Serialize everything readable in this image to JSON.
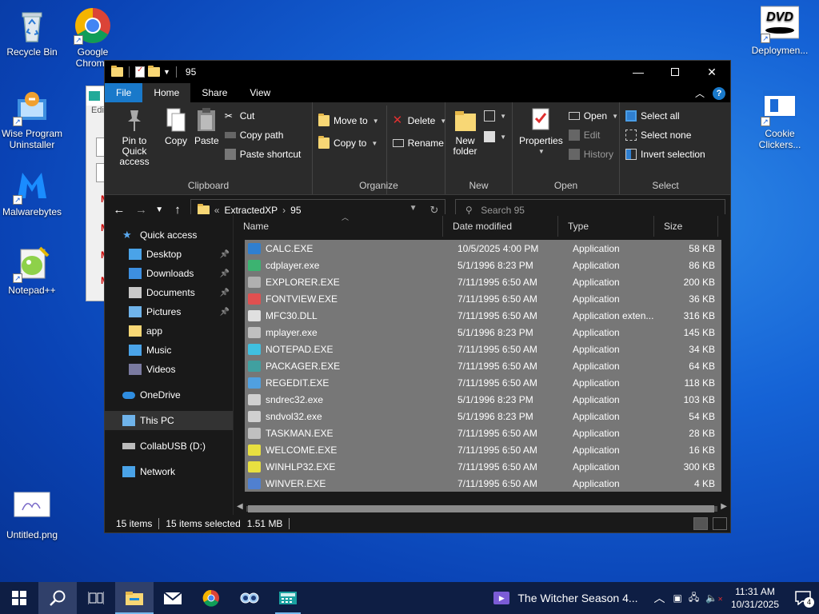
{
  "desktop": {
    "icons_left": [
      {
        "label": "Recycle Bin",
        "icon": "recycle-bin-icon"
      },
      {
        "label": "Google Chrome",
        "icon": "chrome-icon"
      },
      {
        "label": "Wise Program Uninstaller",
        "icon": "uninstaller-icon"
      },
      {
        "label": "Malwarebytes",
        "icon": "malwarebytes-icon"
      },
      {
        "label": "Notepad++",
        "icon": "notepadpp-icon"
      },
      {
        "label": "Untitled.png",
        "icon": "image-file-icon"
      }
    ],
    "icons_right": [
      {
        "label": "Deploymen...",
        "icon": "dvd-icon"
      },
      {
        "label": "Cookie Clickers...",
        "icon": "window-icon"
      }
    ],
    "bg_window_menu": "Edi"
  },
  "explorer": {
    "title": "95",
    "tabs": [
      "File",
      "Home",
      "Share",
      "View"
    ],
    "ribbon": {
      "clipboard": {
        "label": "Clipboard",
        "pin": "Pin to Quick access",
        "copy": "Copy",
        "paste": "Paste",
        "cut": "Cut",
        "copy_path": "Copy path",
        "paste_shortcut": "Paste shortcut"
      },
      "organize": {
        "label": "Organize",
        "move_to": "Move to",
        "copy_to": "Copy to",
        "delete": "Delete",
        "rename": "Rename"
      },
      "new": {
        "label": "New",
        "new_folder": "New folder"
      },
      "open": {
        "label": "Open",
        "properties": "Properties",
        "open": "Open",
        "edit": "Edit",
        "history": "History"
      },
      "select": {
        "label": "Select",
        "select_all": "Select all",
        "select_none": "Select none",
        "invert": "Invert selection"
      }
    },
    "address": {
      "crumbs": [
        "ExtractedXP",
        "95"
      ],
      "overflow": "«"
    },
    "search_placeholder": "Search 95",
    "nav": [
      {
        "label": "Quick access",
        "icon": "star-icon",
        "indent": 1
      },
      {
        "label": "Desktop",
        "icon": "desktop-folder-icon",
        "indent": 2,
        "pinned": true
      },
      {
        "label": "Downloads",
        "icon": "downloads-icon",
        "indent": 2,
        "pinned": true
      },
      {
        "label": "Documents",
        "icon": "documents-icon",
        "indent": 2,
        "pinned": true
      },
      {
        "label": "Pictures",
        "icon": "pictures-icon",
        "indent": 2,
        "pinned": true
      },
      {
        "label": "app",
        "icon": "folder-icon",
        "indent": 2
      },
      {
        "label": "Music",
        "icon": "music-icon",
        "indent": 2
      },
      {
        "label": "Videos",
        "icon": "videos-icon",
        "indent": 2
      },
      {
        "label": "OneDrive",
        "icon": "cloud-icon",
        "indent": 1
      },
      {
        "label": "This PC",
        "icon": "pc-icon",
        "indent": 1,
        "selected": true
      },
      {
        "label": "CollabUSB (D:)",
        "icon": "drive-icon",
        "indent": 1
      },
      {
        "label": "Network",
        "icon": "network-icon",
        "indent": 1
      }
    ],
    "columns": [
      "Name",
      "Date modified",
      "Type",
      "Size"
    ],
    "files": [
      {
        "name": "CALC.EXE",
        "date": "10/5/2025 4:00 PM",
        "type": "Application",
        "size": "58 KB",
        "icon": "calc-icon",
        "color": "#2f7fd0"
      },
      {
        "name": "cdplayer.exe",
        "date": "5/1/1996 8:23 PM",
        "type": "Application",
        "size": "86 KB",
        "icon": "cd-icon",
        "color": "#3cb371"
      },
      {
        "name": "EXPLORER.EXE",
        "date": "7/11/1995 6:50 AM",
        "type": "Application",
        "size": "200 KB",
        "icon": "computer-icon",
        "color": "#b0b0b0"
      },
      {
        "name": "FONTVIEW.EXE",
        "date": "7/11/1995 6:50 AM",
        "type": "Application",
        "size": "36 KB",
        "icon": "font-icon",
        "color": "#e05050"
      },
      {
        "name": "MFC30.DLL",
        "date": "7/11/1995 6:50 AM",
        "type": "Application exten...",
        "size": "316 KB",
        "icon": "dll-icon",
        "color": "#e0e0e0"
      },
      {
        "name": "mplayer.exe",
        "date": "5/1/1996 8:23 PM",
        "type": "Application",
        "size": "145 KB",
        "icon": "media-icon",
        "color": "#c0c0c0"
      },
      {
        "name": "NOTEPAD.EXE",
        "date": "7/11/1995 6:50 AM",
        "type": "Application",
        "size": "34 KB",
        "icon": "notepad-icon",
        "color": "#40c0e0"
      },
      {
        "name": "PACKAGER.EXE",
        "date": "7/11/1995 6:50 AM",
        "type": "Application",
        "size": "64 KB",
        "icon": "package-icon",
        "color": "#40a0a0"
      },
      {
        "name": "REGEDIT.EXE",
        "date": "7/11/1995 6:50 AM",
        "type": "Application",
        "size": "118 KB",
        "icon": "registry-icon",
        "color": "#50a0e0"
      },
      {
        "name": "sndrec32.exe",
        "date": "5/1/1996 8:23 PM",
        "type": "Application",
        "size": "103 KB",
        "icon": "speaker-icon",
        "color": "#d0d0d0"
      },
      {
        "name": "sndvol32.exe",
        "date": "5/1/1996 8:23 PM",
        "type": "Application",
        "size": "54 KB",
        "icon": "volume-icon",
        "color": "#d0d0d0"
      },
      {
        "name": "TASKMAN.EXE",
        "date": "7/11/1995 6:50 AM",
        "type": "Application",
        "size": "28 KB",
        "icon": "taskman-icon",
        "color": "#c0c0c0"
      },
      {
        "name": "WELCOME.EXE",
        "date": "7/11/1995 6:50 AM",
        "type": "Application",
        "size": "16 KB",
        "icon": "bulb-icon",
        "color": "#e8e040"
      },
      {
        "name": "WINHLP32.EXE",
        "date": "7/11/1995 6:50 AM",
        "type": "Application",
        "size": "300 KB",
        "icon": "help-icon",
        "color": "#e8e040"
      },
      {
        "name": "WINVER.EXE",
        "date": "7/11/1995 6:50 AM",
        "type": "Application",
        "size": "4 KB",
        "icon": "winver-icon",
        "color": "#5080d0"
      }
    ],
    "status": {
      "count": "15 items",
      "selected": "15 items selected",
      "size": "1.51 MB"
    }
  },
  "taskbar": {
    "media_title": "The Witcher Season 4...",
    "time": "11:31 AM",
    "date": "10/31/2025",
    "notification_count": "4"
  }
}
